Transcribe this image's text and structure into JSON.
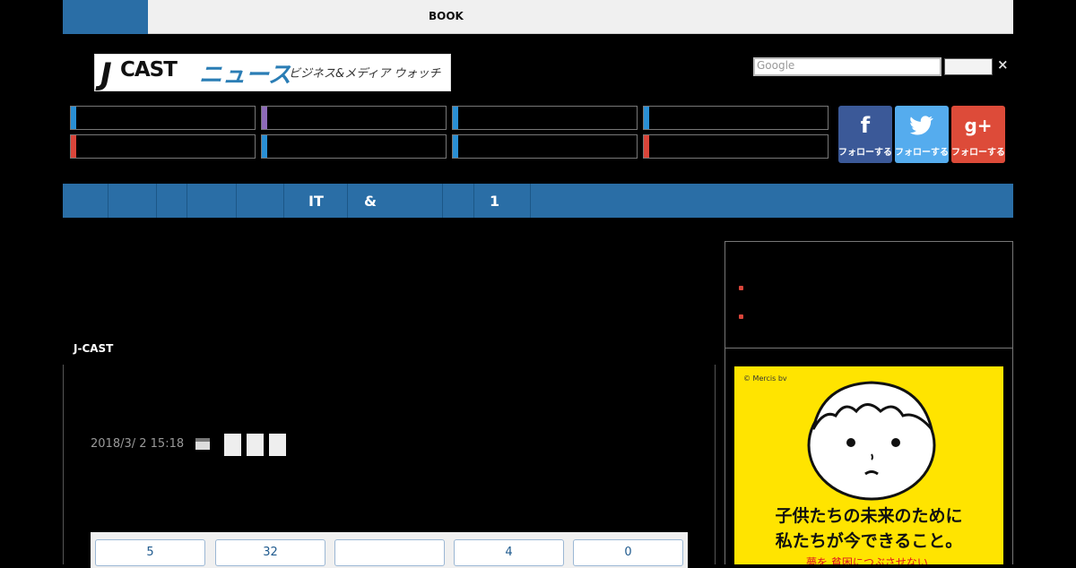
{
  "topbar": {
    "book_label": "BOOK"
  },
  "logo": {
    "j": "J",
    "cast": "CAST",
    "news": "ニュース",
    "tagline": "ビジネス&メディア ウォッチ"
  },
  "search": {
    "placeholder": "Google",
    "close": "×"
  },
  "categories": [
    {
      "accent": "#2a8fd4"
    },
    {
      "accent": "#8e6bb8"
    },
    {
      "accent": "#2a8fd4"
    },
    {
      "accent": "#2a8fd4"
    },
    {
      "accent": "#d9453a"
    },
    {
      "accent": "#2a8fd4"
    },
    {
      "accent": "#2a8fd4"
    },
    {
      "accent": "#d9453a"
    }
  ],
  "social": [
    {
      "network": "facebook",
      "glyph": "f",
      "label": "フォローする",
      "color": "#3b5998"
    },
    {
      "network": "twitter",
      "glyph": "🐦",
      "label": "フォローする",
      "color": "#55acee"
    },
    {
      "network": "googleplus",
      "glyph": "g+",
      "label": "フォローする",
      "color": "#dd4b39"
    }
  ],
  "nav": {
    "it": "IT",
    "amp": "&",
    "one": "1"
  },
  "article": {
    "source": "J-CAST",
    "date": "2018/3/ 2 15:18"
  },
  "stats": [
    "5",
    "32",
    "",
    "4",
    "0"
  ],
  "ad": {
    "credit": "© Mercis bv",
    "line1": "子供たちの未来のために",
    "line2": "私たちが今できること。",
    "line3": "夢を 貧困につぶさせない"
  },
  "colors": {
    "nav_blue": "#2a6ea6",
    "ad_yellow": "#ffe400"
  }
}
